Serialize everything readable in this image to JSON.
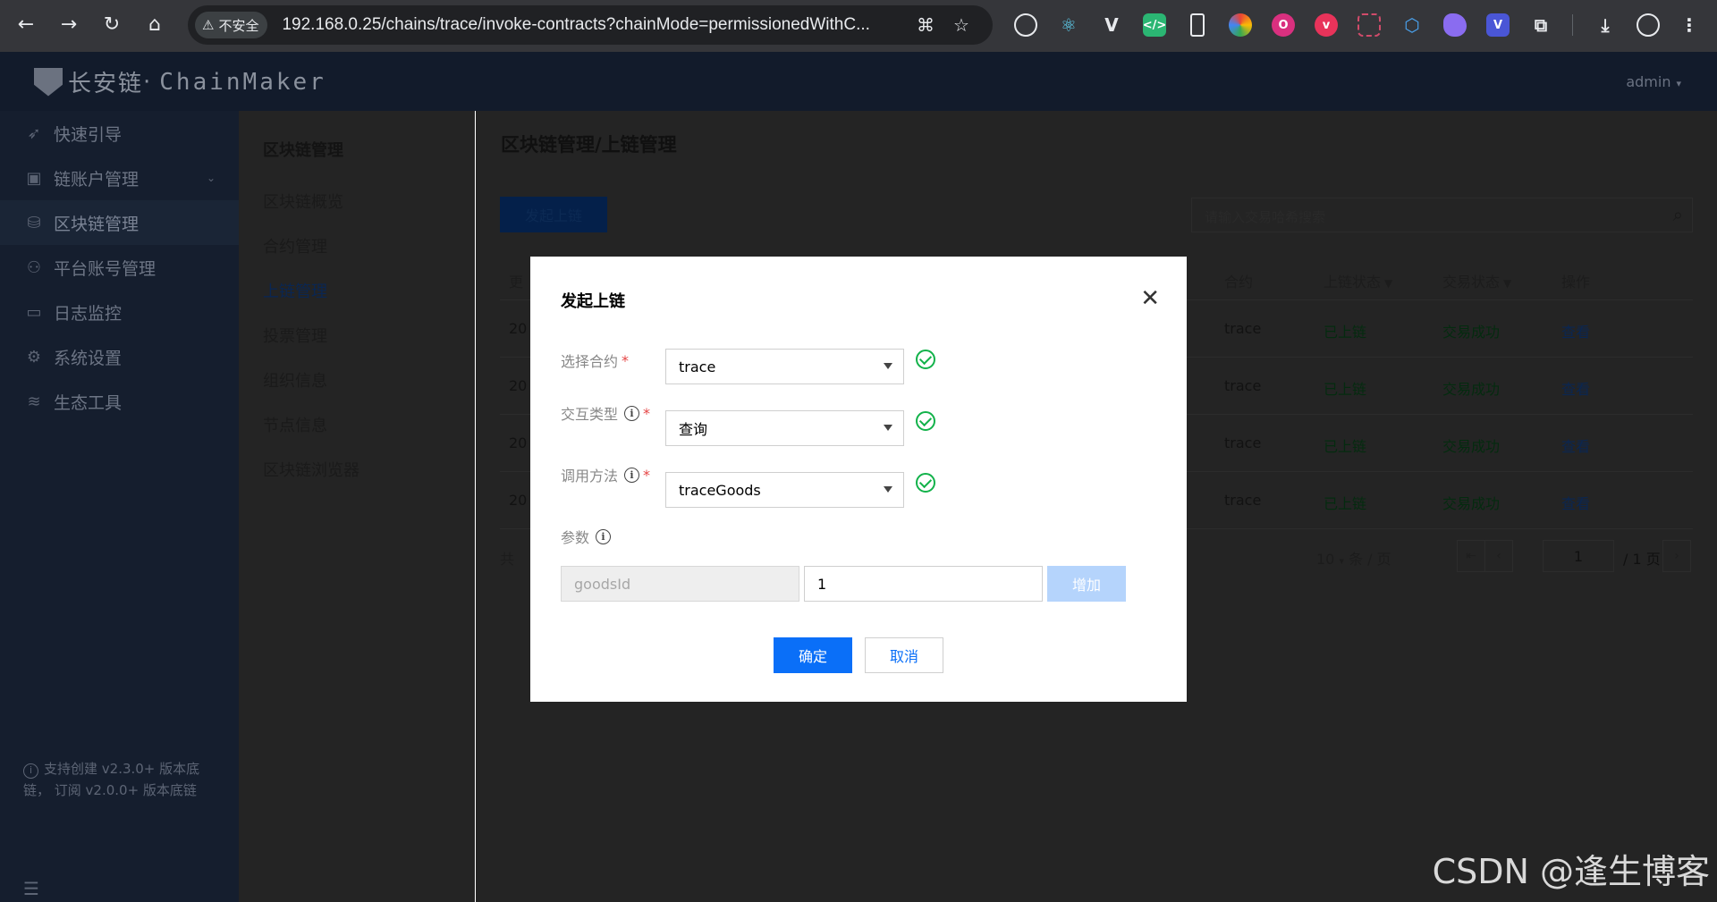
{
  "browser": {
    "security_label": "不安全",
    "url": "192.168.0.25/chains/trace/invoke-contracts?chainMode=permissionedWithC..."
  },
  "app": {
    "brand_cn": "长安链",
    "brand_en": "ChainMaker",
    "user": "admin"
  },
  "sidebar": {
    "items": [
      {
        "label": "快速引导",
        "icon": "rocket-icon"
      },
      {
        "label": "链账户管理",
        "icon": "account-icon"
      },
      {
        "label": "区块链管理",
        "icon": "blockchain-icon"
      },
      {
        "label": "平台账号管理",
        "icon": "user-icon"
      },
      {
        "label": "日志监控",
        "icon": "monitor-icon"
      },
      {
        "label": "系统设置",
        "icon": "gear-icon"
      },
      {
        "label": "生态工具",
        "icon": "layers-icon"
      }
    ],
    "note": "支持创建 v2.3.0+ 版本底链， 订阅 v2.0.0+ 版本底链"
  },
  "subsidebar": {
    "title": "区块链管理",
    "items": [
      "区块链概览",
      "合约管理",
      "上链管理",
      "投票管理",
      "组织信息",
      "节点信息",
      "区块链浏览器"
    ]
  },
  "main": {
    "title": "区块链管理/上链管理",
    "primary_button": "发起上链",
    "search_placeholder": "请输入交易哈希搜索",
    "columns": {
      "first": "更",
      "contract": "合约",
      "chain_status": "上链状态",
      "tx_status": "交易状态",
      "action": "操作"
    },
    "rows": [
      {
        "first": "20",
        "contract": "trace",
        "chain_status": "已上链",
        "tx_status": "交易成功",
        "action": "查看"
      },
      {
        "first": "20",
        "contract": "trace",
        "chain_status": "已上链",
        "tx_status": "交易成功",
        "action": "查看"
      },
      {
        "first": "20",
        "contract": "trace",
        "chain_status": "已上链",
        "tx_status": "交易成功",
        "action": "查看"
      },
      {
        "first": "20",
        "contract": "trace",
        "chain_status": "已上链",
        "tx_status": "交易成功",
        "action": "查看"
      }
    ],
    "pager": {
      "total": "共",
      "page_size": "10",
      "per_page": "条 / 页",
      "current_page": "1",
      "total_pages": "/ 1 页"
    }
  },
  "modal": {
    "title": "发起上链",
    "fields": {
      "contract_label": "选择合约",
      "contract_value": "trace",
      "type_label": "交互类型",
      "type_value": "查询",
      "method_label": "调用方法",
      "method_value": "traceGoods",
      "params_label": "参数",
      "param_key": "goodsId",
      "param_value": "1"
    },
    "add_button": "增加",
    "confirm_button": "确定",
    "cancel_button": "取消"
  },
  "watermark": "CSDN @逢生博客",
  "colors": {
    "primary": "#0a6ff8",
    "success": "#12b24a",
    "required": "#e54545"
  }
}
